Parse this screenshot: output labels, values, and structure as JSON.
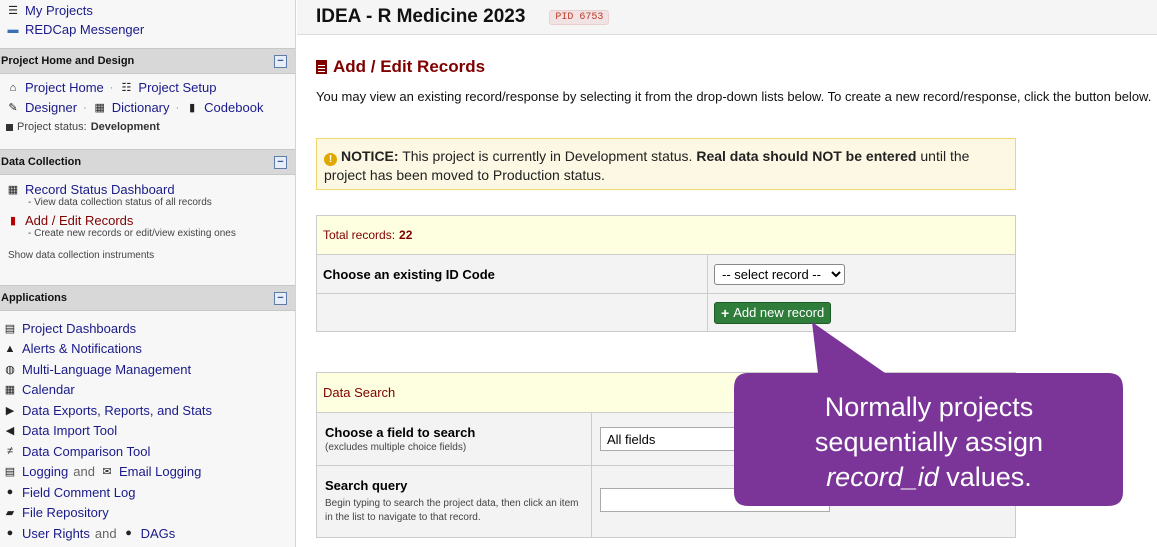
{
  "sidebar": {
    "top_links": [
      {
        "label": "My Projects",
        "icon": "list-icon"
      },
      {
        "label": "REDCap Messenger",
        "icon": "chat-icon"
      }
    ],
    "project_home": {
      "header": "Project Home and Design",
      "project_home": "Project Home",
      "project_setup": "Project Setup",
      "designer": "Designer",
      "dictionary": "Dictionary",
      "codebook": "Codebook",
      "status_label": "Project status:",
      "status_value": "Development"
    },
    "data_collection": {
      "header": "Data Collection",
      "record_status": "Record Status Dashboard",
      "record_status_sub": "- View data collection status of all records",
      "add_edit": "Add / Edit Records",
      "add_edit_sub": "- Create new records or edit/view existing ones",
      "show_instruments": "Show data collection instruments"
    },
    "applications": {
      "header": "Applications",
      "items": [
        "Project Dashboards",
        "Alerts & Notifications",
        "Multi-Language Management",
        "Calendar",
        "Data Exports, Reports, and Stats",
        "Data Import Tool",
        "Data Comparison Tool"
      ],
      "logging": "Logging",
      "and": "and",
      "email_logging": "Email Logging",
      "field_comment_log": "Field Comment Log",
      "file_repository": "File Repository",
      "user_rights": "User Rights",
      "dags": "DAGs"
    }
  },
  "header": {
    "project_title": "IDEA - R Medicine 2023",
    "pid": "PID 6753"
  },
  "main": {
    "heading": "Add / Edit Records",
    "intro": "You may view an existing record/response by selecting it from the drop-down lists below. To create a new record/response, click the button below.",
    "notice_label": "NOTICE:",
    "notice_text1": " This project is currently in Development status. ",
    "notice_bold": "Real data should NOT be entered",
    "notice_text2": " until the project has been moved to Production status.",
    "total_records_label": "Total records:",
    "total_records": "22",
    "choose_id_label": "Choose an existing ID Code",
    "select_record": "-- select record --",
    "add_new_record": "Add new record",
    "data_search_header": "Data Search",
    "choose_field_label": "Choose a field to search",
    "choose_field_sub": "(excludes multiple choice fields)",
    "field_value": "All fields",
    "search_query_label": "Search query",
    "search_query_sub": "Begin typing to search the project data, then click an item in the list to navigate to that record."
  },
  "callout": {
    "line1": "Normally projects",
    "line2": "sequentially assign",
    "line3_em": "record_id",
    "line3_rest": " values.",
    "color": "#7b3599"
  },
  "colors": {
    "heading": "#800000",
    "link": "#1a1a8a",
    "add_button": "#2f7d3a",
    "notice_bg": "#fcf8e3"
  }
}
